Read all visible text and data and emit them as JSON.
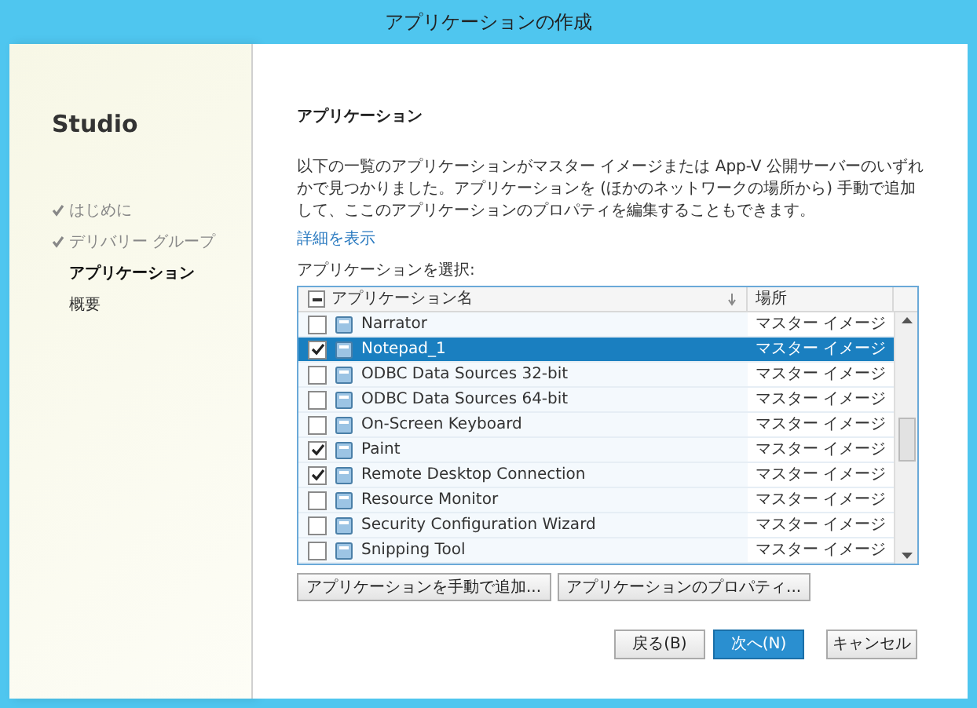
{
  "window": {
    "title": "アプリケーションの作成"
  },
  "sidebar": {
    "title": "Studio",
    "items": [
      {
        "label": "はじめに",
        "checked": true,
        "selected": false
      },
      {
        "label": "デリバリー グループ",
        "checked": true,
        "selected": false
      },
      {
        "label": "アプリケーション",
        "checked": false,
        "selected": true
      },
      {
        "label": "概要",
        "checked": false,
        "selected": false
      }
    ]
  },
  "page": {
    "heading": "アプリケーション",
    "description": "以下の一覧のアプリケーションがマスター イメージまたは App-V 公開サーバーのいずれかで見つかりました。アプリケーションを (ほかのネットワークの場所から) 手動で追加して、ここのアプリケーションのプロパティを編集することもできます。",
    "link": "詳細を表示",
    "select_label": "アプリケーションを選択:"
  },
  "table": {
    "select_all_partial": true,
    "columns": [
      "アプリケーション名",
      "場所"
    ],
    "rows": [
      {
        "name": "Narrator",
        "location": "マスター イメージ",
        "checked": false,
        "selected": false
      },
      {
        "name": "Notepad_1",
        "location": "マスター イメージ",
        "checked": true,
        "selected": true
      },
      {
        "name": "ODBC Data Sources 32-bit",
        "location": "マスター イメージ",
        "checked": false,
        "selected": false
      },
      {
        "name": "ODBC Data Sources 64-bit",
        "location": "マスター イメージ",
        "checked": false,
        "selected": false
      },
      {
        "name": "On-Screen Keyboard",
        "location": "マスター イメージ",
        "checked": false,
        "selected": false
      },
      {
        "name": "Paint",
        "location": "マスター イメージ",
        "checked": true,
        "selected": false
      },
      {
        "name": "Remote Desktop Connection",
        "location": "マスター イメージ",
        "checked": true,
        "selected": false
      },
      {
        "name": "Resource Monitor",
        "location": "マスター イメージ",
        "checked": false,
        "selected": false
      },
      {
        "name": "Security Configuration Wizard",
        "location": "マスター イメージ",
        "checked": false,
        "selected": false
      },
      {
        "name": "Snipping Tool",
        "location": "マスター イメージ",
        "checked": false,
        "selected": false
      }
    ]
  },
  "table_buttons": [
    "アプリケーションを手動で追加...",
    "アプリケーションのプロパティ..."
  ],
  "footer_buttons": [
    {
      "label": "戻る(B)",
      "primary": false
    },
    {
      "label": "次へ(N)",
      "primary": true
    },
    {
      "label": "キャンセル",
      "primary": false
    }
  ]
}
